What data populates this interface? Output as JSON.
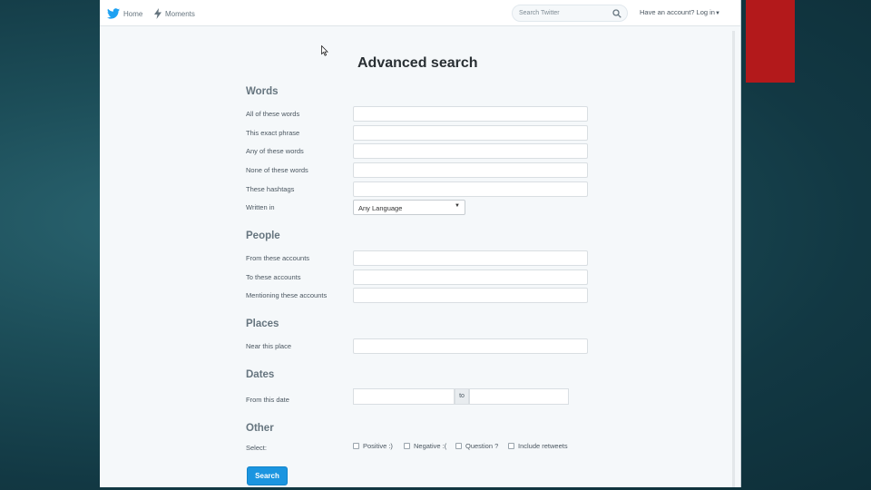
{
  "nav": {
    "home_label": "Home",
    "moments_label": "Moments",
    "search_placeholder": "Search Twitter",
    "account_prompt": "Have an account? Log in"
  },
  "page_title": "Advanced search",
  "sections": {
    "words": {
      "title": "Words",
      "all_words": "All of these words",
      "exact_phrase": "This exact phrase",
      "any_words": "Any of these words",
      "none_words": "None of these words",
      "hashtags": "These hashtags",
      "written_in": "Written in",
      "language_value": "Any Language"
    },
    "people": {
      "title": "People",
      "from_accounts": "From these accounts",
      "to_accounts": "To these accounts",
      "mentioning_accounts": "Mentioning these accounts"
    },
    "places": {
      "title": "Places",
      "near_place": "Near this place"
    },
    "dates": {
      "title": "Dates",
      "from_date": "From this date",
      "to_label": "to"
    },
    "other": {
      "title": "Other",
      "select_label": "Select:",
      "options": [
        "Positive :)",
        "Negative :(",
        "Question ?",
        "Include retweets"
      ]
    }
  },
  "search_button_label": "Search",
  "colors": {
    "twitter_blue": "#1b95e0",
    "accent_red": "#b3191b",
    "background_teal": "#1c4d58"
  }
}
